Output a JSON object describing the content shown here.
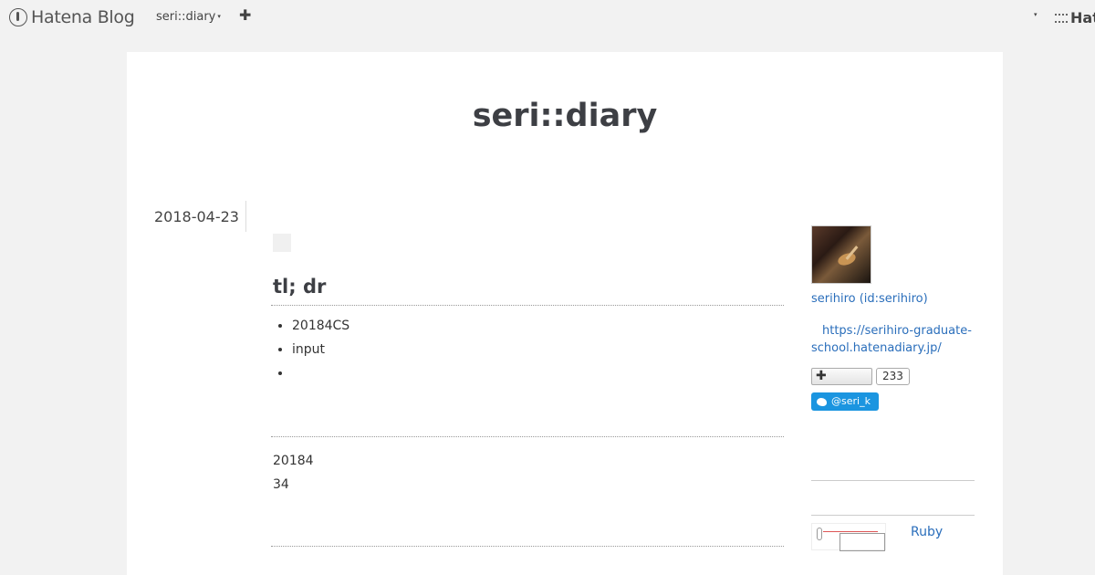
{
  "globalheader": {
    "logo_text": "Hatena Blog",
    "blog_switch_label": "seri::diary",
    "add_label": "✚",
    "right_logo_text": "Hat",
    "caret": "▾"
  },
  "blog": {
    "title": "seri::diary"
  },
  "entry": {
    "date": "2018-04-23",
    "heading": "tl; dr",
    "bullets": [
      "20184CS",
      "input",
      ""
    ],
    "paragraphs": [
      "20184",
      "34"
    ]
  },
  "sidebar": {
    "user_link": "serihiro (id:serihiro)",
    "url_line1": "https://serihiro-graduate-",
    "url_line2": "school.hatenadiary.jp/",
    "follow_label": "✚",
    "follow_count": "233",
    "twitter_label": "@seri_k",
    "related_title": "Ruby"
  }
}
